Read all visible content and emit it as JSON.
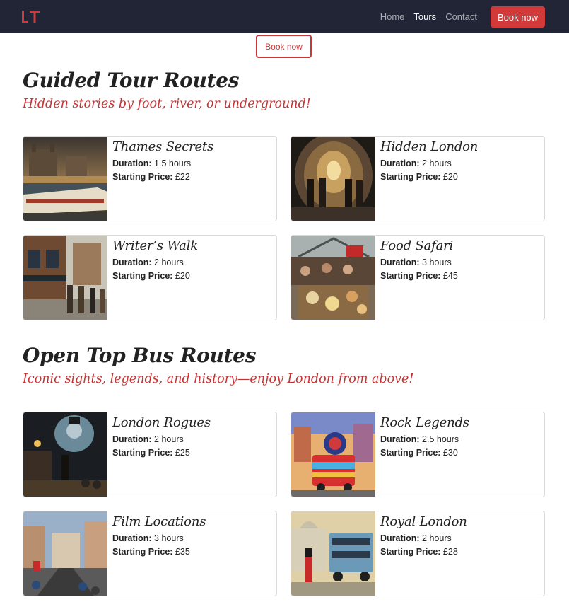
{
  "navbar": {
    "logo": "LT",
    "links": [
      {
        "label": "Home",
        "active": false
      },
      {
        "label": "Tours",
        "active": true
      },
      {
        "label": "Contact",
        "active": false
      }
    ],
    "book_label": "Book now"
  },
  "hero_book_label": "Book now",
  "sections": [
    {
      "title": "Guided Tour Routes",
      "subtitle": "Hidden stories by foot, river, or underground!",
      "tours": [
        {
          "name": "Thames Secrets",
          "duration_label": "Duration:",
          "duration": "1.5 hours",
          "price_label": "Starting Price:",
          "price": "£22"
        },
        {
          "name": "Hidden London",
          "duration_label": "Duration:",
          "duration": "2 hours",
          "price_label": "Starting Price:",
          "price": "£20"
        },
        {
          "name": "Writer’s Walk",
          "duration_label": "Duration:",
          "duration": "2 hours",
          "price_label": "Starting Price:",
          "price": "£20"
        },
        {
          "name": "Food Safari",
          "duration_label": "Duration:",
          "duration": "3 hours",
          "price_label": "Starting Price:",
          "price": "£45"
        }
      ]
    },
    {
      "title": "Open Top Bus Routes",
      "subtitle": "Iconic sights, legends, and history—enjoy London from above!",
      "tours": [
        {
          "name": "London Rogues",
          "duration_label": "Duration:",
          "duration": "2 hours",
          "price_label": "Starting Price:",
          "price": "£25"
        },
        {
          "name": "Rock Legends",
          "duration_label": "Duration:",
          "duration": "2.5 hours",
          "price_label": "Starting Price:",
          "price": "£30"
        },
        {
          "name": "Film Locations",
          "duration_label": "Duration:",
          "duration": "3 hours",
          "price_label": "Starting Price:",
          "price": "£35"
        },
        {
          "name": "Royal London",
          "duration_label": "Duration:",
          "duration": "2 hours",
          "price_label": "Starting Price:",
          "price": "£28"
        }
      ]
    }
  ],
  "colors": {
    "navbar_bg": "#222536",
    "accent": "#d23a3a",
    "subtitle": "#c53434"
  }
}
